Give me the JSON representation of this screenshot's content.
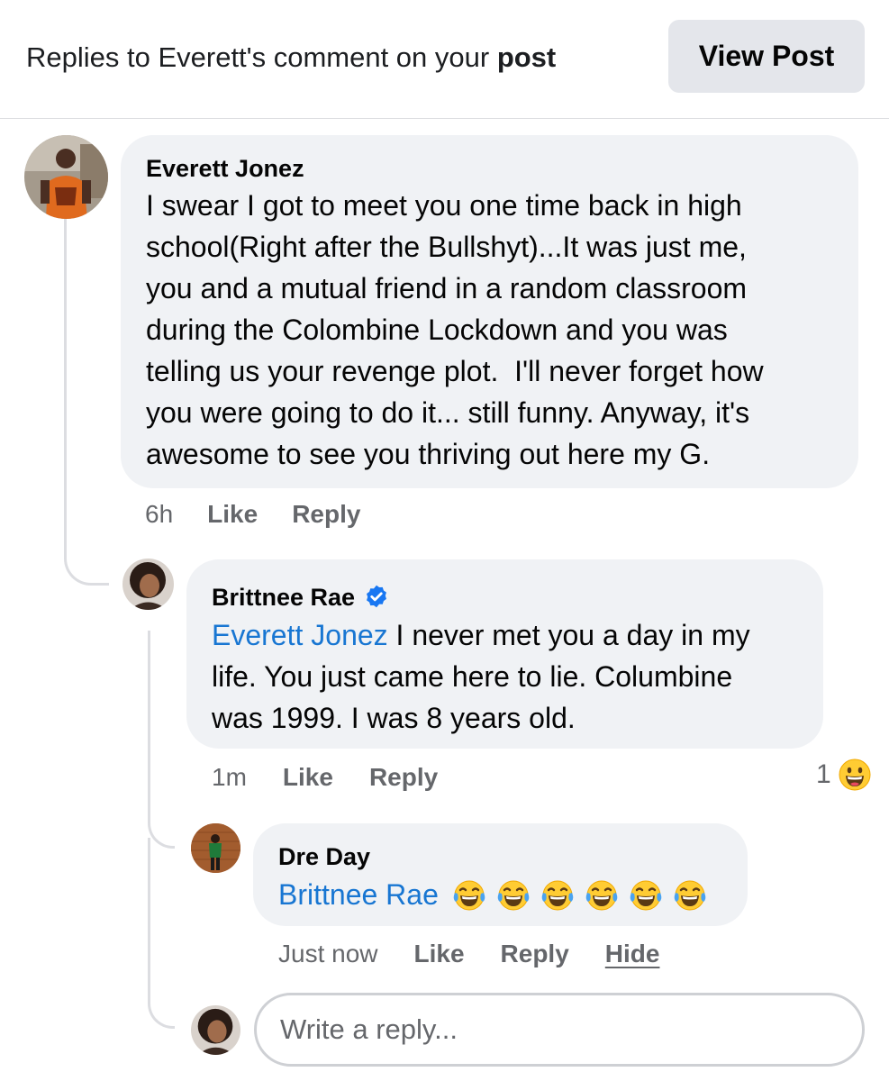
{
  "header": {
    "title_prefix": "Replies to Everett's comment on your ",
    "title_bold": "post",
    "view_post_label": "View Post"
  },
  "comments": [
    {
      "author": "Everett Jonez",
      "lines": [
        "I swear I got to meet you one time back in high",
        "school(Right after the Bullshyt)...It was just me,",
        "you and a mutual friend in a random classroom",
        "during the Colombine Lockdown and you was",
        "telling us your revenge plot.  I'll never forget how",
        "you were going to do it... still funny. Anyway, it's",
        "awesome to see you thriving out here my G."
      ],
      "time": "6h",
      "like_label": "Like",
      "reply_label": "Reply"
    },
    {
      "author": "Brittnee Rae",
      "verified": true,
      "mention": "Everett Jonez",
      "line1_rest": " I never met you a day in my",
      "line2": "life. You just came here to lie. Columbine",
      "line3": "was 1999. I was 8 years old.",
      "time": "1m",
      "like_label": "Like",
      "reply_label": "Reply",
      "reaction_count": "1",
      "reaction_icon": "grinning-face-icon"
    },
    {
      "author": "Dre Day",
      "mention": "Brittnee Rae",
      "emoji_icon": "tears-of-joy-icon",
      "emoji_count": 6,
      "time": "Just now",
      "like_label": "Like",
      "reply_label": "Reply",
      "hide_label": "Hide"
    }
  ],
  "reply_box": {
    "placeholder": "Write a reply..."
  },
  "colors": {
    "bubble": "#f0f2f5",
    "mention": "#1876d2",
    "secondary_text": "#65676b",
    "verified_badge": "#1877f2"
  }
}
